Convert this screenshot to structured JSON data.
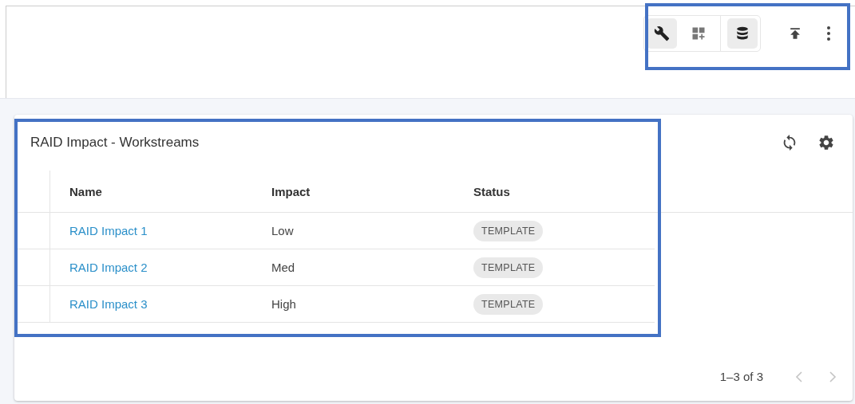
{
  "toolbar": {
    "highlighted": true,
    "tools": [
      {
        "kind": "wrench",
        "selected": true
      },
      {
        "kind": "grid-add",
        "selected": false
      },
      {
        "kind": "database",
        "selected": true
      }
    ],
    "actions": [
      {
        "kind": "upload"
      },
      {
        "kind": "more"
      }
    ]
  },
  "card": {
    "title": "RAID Impact - Workstreams",
    "highlighted": true,
    "columns": [
      "Name",
      "Impact",
      "Status"
    ],
    "rows": [
      {
        "name": "RAID Impact 1",
        "impact": "Low",
        "status": "TEMPLATE"
      },
      {
        "name": "RAID Impact 2",
        "impact": "Med",
        "status": "TEMPLATE"
      },
      {
        "name": "RAID Impact 3",
        "impact": "High",
        "status": "TEMPLATE"
      }
    ],
    "pagination": {
      "range": "1–3 of 3",
      "previous_disabled": true,
      "next_disabled": true
    }
  }
}
